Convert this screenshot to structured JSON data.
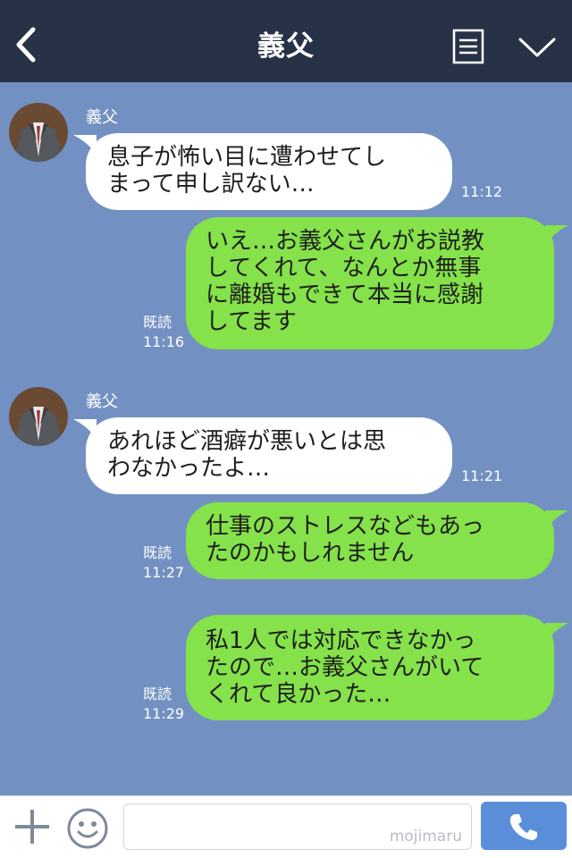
{
  "header": {
    "title": "義父"
  },
  "messages": [
    {
      "sender": "義父",
      "text": "息子が怖い目に遭わせてし\nまって申し訳ない…",
      "time": "11:12"
    },
    {
      "read": "既読",
      "text": "いえ…お義父さんがお説教\nしてくれて、なんとか無事\nに離婚もできて本当に感謝\nしてます",
      "time": "11:16"
    },
    {
      "sender": "義父",
      "text": "あれほど酒癖が悪いとは思\nわなかったよ…",
      "time": "11:21"
    },
    {
      "read": "既読",
      "text": "仕事のストレスなどもあっ\nたのかもしれません",
      "time": "11:27"
    },
    {
      "read": "既読",
      "text": "私1人では対応できなかっ\nたので…お義父さんがいて\nくれて良かった…",
      "time": "11:29"
    }
  ],
  "footer": {
    "watermark": "mojimaru"
  },
  "colors": {
    "header_bg": "#273246",
    "chat_bg": "#7291c2",
    "outgoing_bubble": "#85e24a",
    "incoming_bubble": "#ffffff",
    "call_button": "#5b8ed9"
  },
  "icons": {
    "back": "chevron-left-icon",
    "menu": "menu-list-icon",
    "collapse": "chevron-down-icon",
    "attach": "plus-icon",
    "emoji": "smiley-icon",
    "call": "phone-icon"
  }
}
